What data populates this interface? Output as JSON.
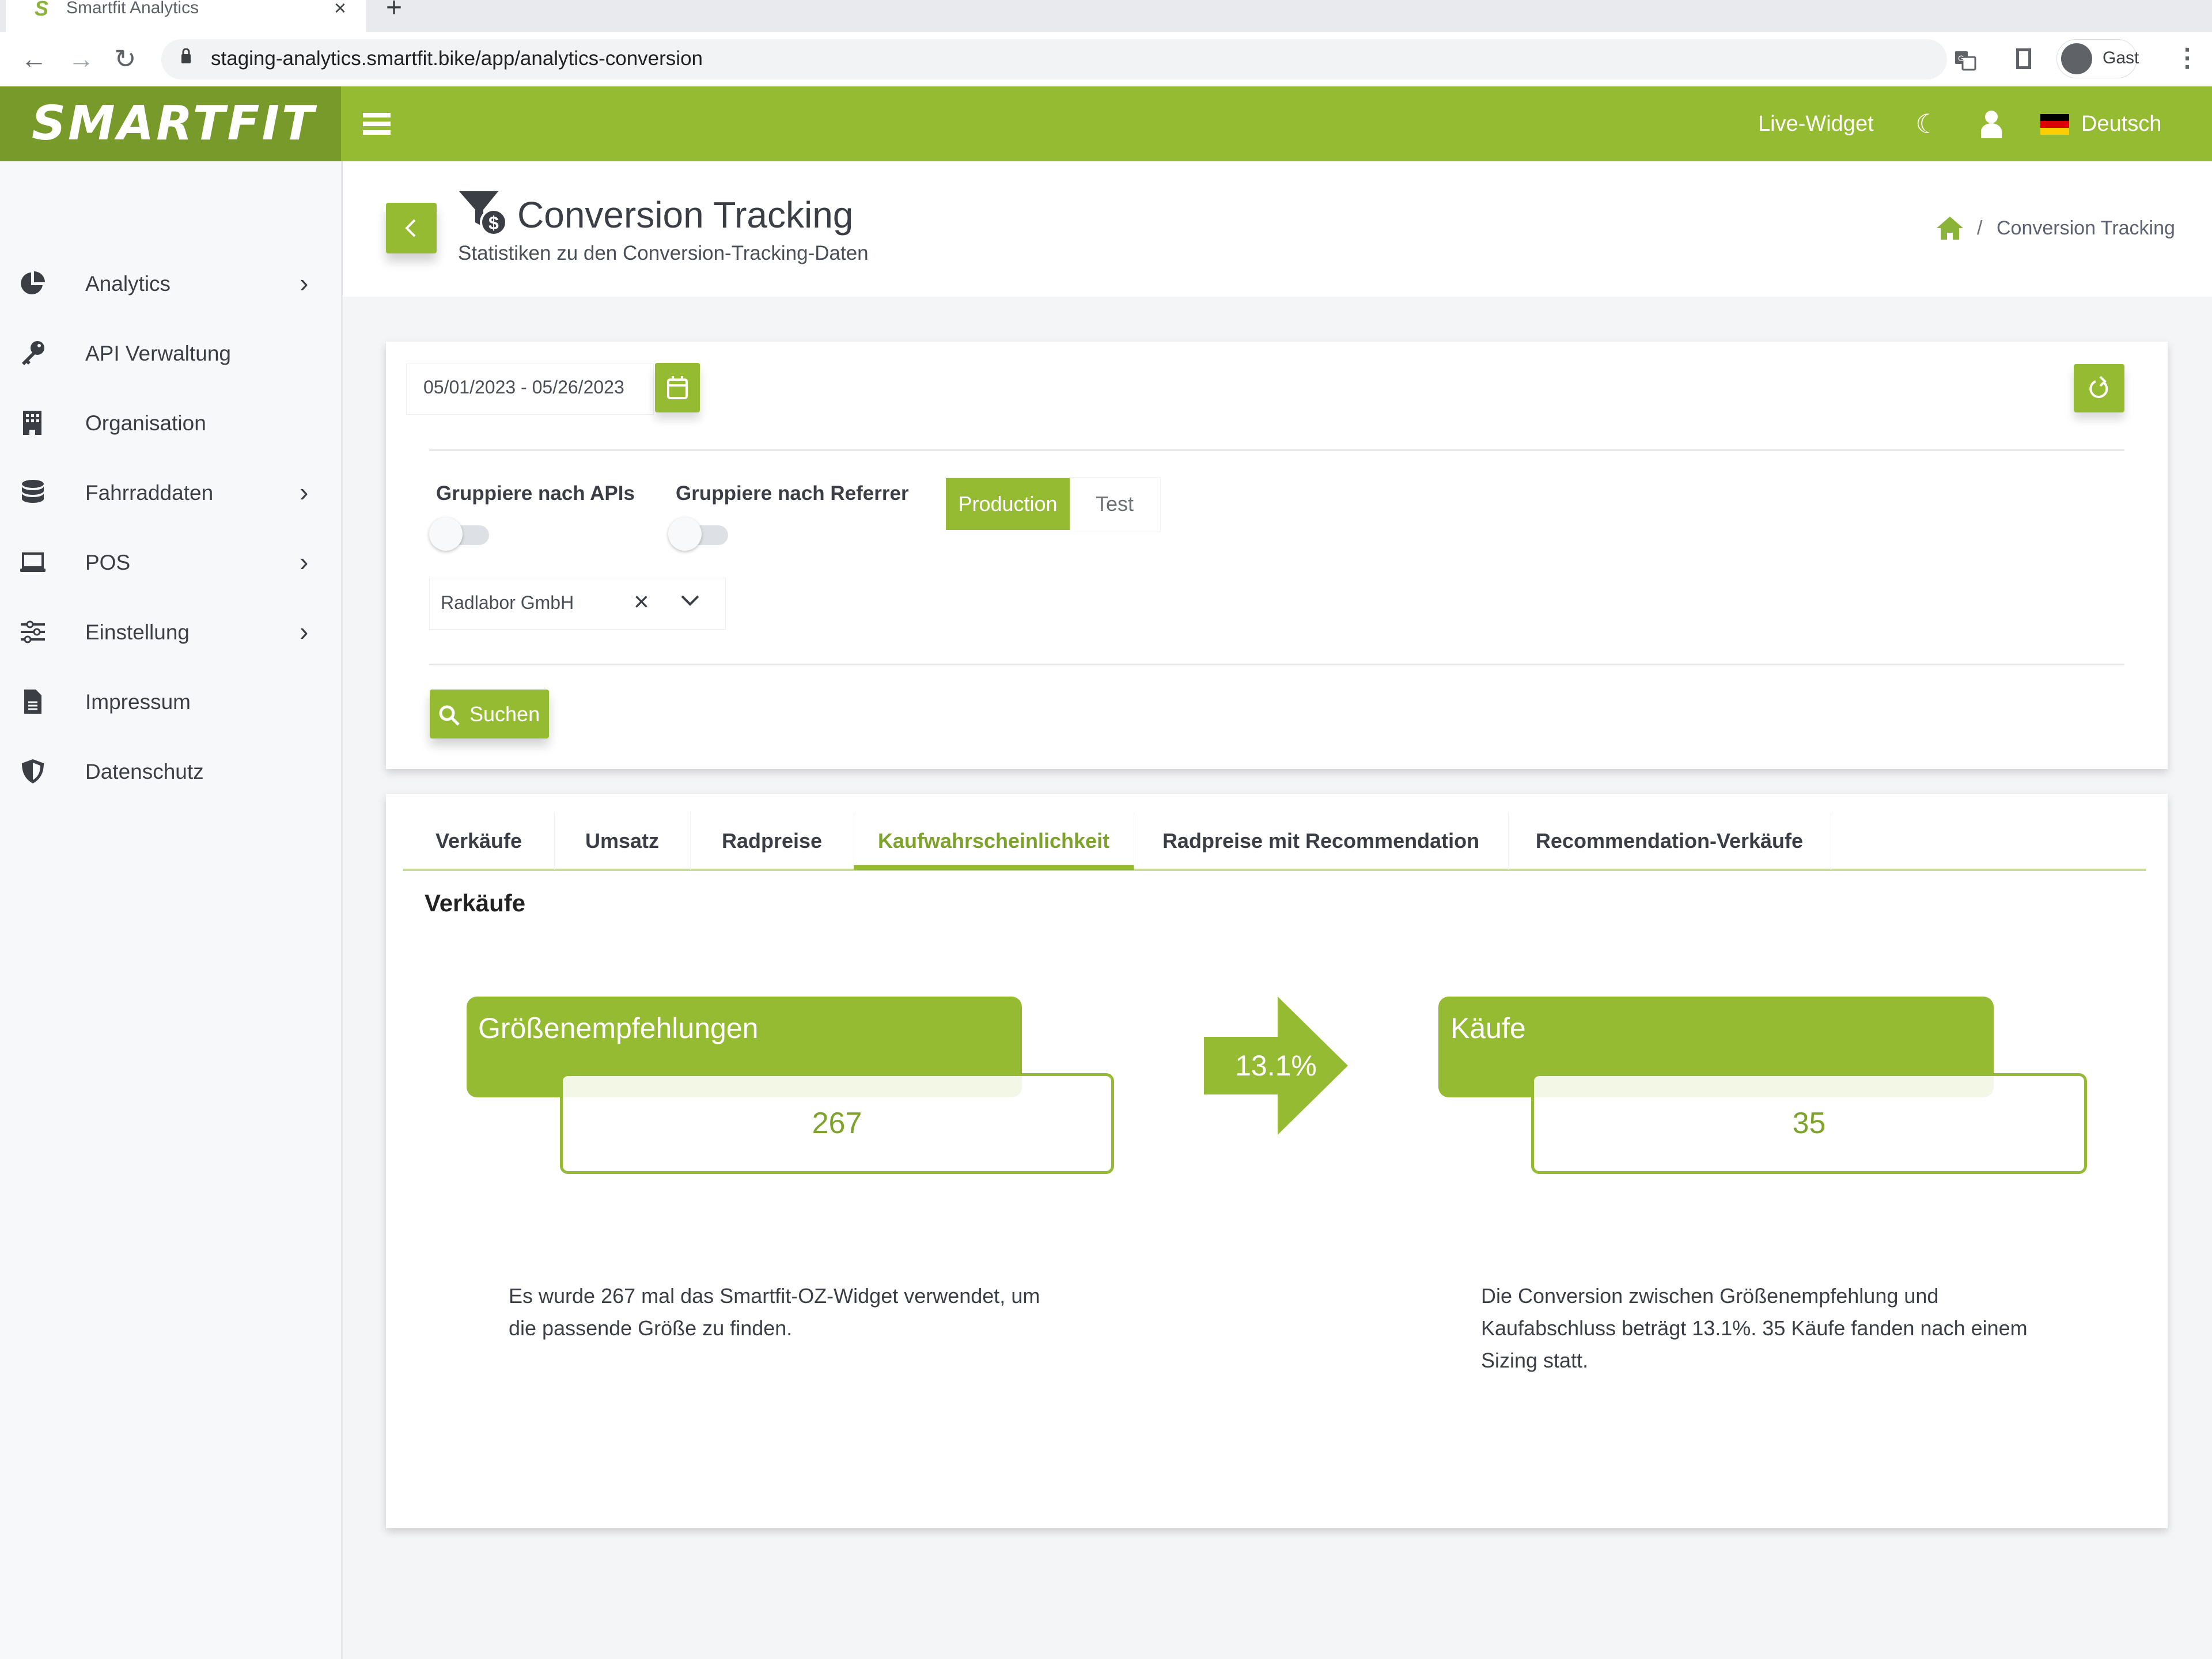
{
  "browser": {
    "tab_title": "Smartfit Analytics",
    "favicon": "S",
    "url": "staging-analytics.smartfit.bike/app/analytics-conversion",
    "profile_name": "Gast"
  },
  "header": {
    "logo": "SMARTFIT",
    "live_widget": "Live-Widget",
    "language": "Deutsch",
    "colors": {
      "primary": "#95bb33",
      "logo_bg": "#789a2b"
    }
  },
  "sidebar": {
    "items": [
      {
        "label": "Analytics",
        "icon": "pie-chart-icon",
        "has_submenu": true
      },
      {
        "label": "API Verwaltung",
        "icon": "key-icon",
        "has_submenu": false
      },
      {
        "label": "Organisation",
        "icon": "building-icon",
        "has_submenu": false
      },
      {
        "label": "Fahrraddaten",
        "icon": "database-icon",
        "has_submenu": true
      },
      {
        "label": "POS",
        "icon": "laptop-icon",
        "has_submenu": true
      },
      {
        "label": "Einstellung",
        "icon": "sliders-icon",
        "has_submenu": true
      },
      {
        "label": "Impressum",
        "icon": "document-icon",
        "has_submenu": false
      },
      {
        "label": "Datenschutz",
        "icon": "shield-icon",
        "has_submenu": false
      }
    ]
  },
  "page": {
    "title": "Conversion Tracking",
    "subtitle": "Statistiken zu den Conversion-Tracking-Daten",
    "breadcrumb": {
      "separator": "/",
      "current": "Conversion Tracking"
    }
  },
  "filters": {
    "date_range": "05/01/2023 - 05/26/2023",
    "group_by_apis": {
      "label": "Gruppiere nach APIs",
      "enabled": false
    },
    "group_by_referrer": {
      "label": "Gruppiere nach Referrer",
      "enabled": false
    },
    "environment": {
      "options": [
        "Production",
        "Test"
      ],
      "selected": "Production"
    },
    "organisation": "Radlabor GmbH",
    "search_label": "Suchen"
  },
  "tabs": {
    "items": [
      "Verkäufe",
      "Umsatz",
      "Radpreise",
      "Kaufwahrscheinlichkeit",
      "Radpreise mit Recommendation",
      "Recommendation-Verkäufe"
    ],
    "active": "Kaufwahrscheinlichkeit"
  },
  "section": {
    "title": "Verkäufe",
    "left": {
      "label": "Größenempfehlungen",
      "value": "267",
      "description": "Es wurde 267 mal das Smartfit-OZ-Widget verwendet, um die passende Größe zu finden."
    },
    "conversion_rate": "13.1%",
    "right": {
      "label": "Käufe",
      "value": "35",
      "description": "Die Conversion zwischen Größenempfehlung und Kaufabschluss beträgt 13.1%. 35 Käufe fanden nach einem Sizing statt."
    }
  }
}
